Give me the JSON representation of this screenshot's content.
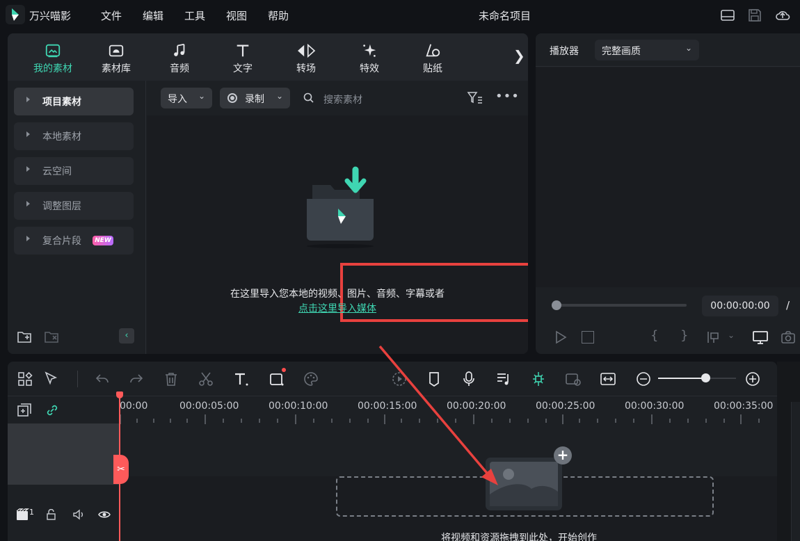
{
  "app": {
    "name": "万兴喵影",
    "project_title": "未命名项目",
    "menus": [
      "文件",
      "编辑",
      "工具",
      "视图",
      "帮助"
    ]
  },
  "media": {
    "tabs": [
      {
        "label": "我的素材",
        "icon": "my-media-icon"
      },
      {
        "label": "素材库",
        "icon": "stock-library-icon"
      },
      {
        "label": "音频",
        "icon": "music-note-icon"
      },
      {
        "label": "文字",
        "icon": "text-t-icon"
      },
      {
        "label": "转场",
        "icon": "transition-icon"
      },
      {
        "label": "特效",
        "icon": "effects-sparkle-icon"
      },
      {
        "label": "贴纸",
        "icon": "sticker-icon"
      }
    ],
    "sidebar": [
      {
        "label": "项目素材"
      },
      {
        "label": "本地素材"
      },
      {
        "label": "云空间"
      },
      {
        "label": "调整图层"
      },
      {
        "label": "复合片段",
        "badge": "NEW"
      }
    ],
    "toolbar": {
      "import_label": "导入",
      "record_label": "录制",
      "search_placeholder": "搜索素材"
    },
    "empty": {
      "text": "在这里导入您本地的视频、图片、音频、字幕或者",
      "link": "点击这里导入媒体"
    }
  },
  "player": {
    "title": "播放器",
    "quality": "完整画质",
    "timecode": "00:00:00:00",
    "separator": "/"
  },
  "timeline": {
    "ruler": [
      "00:00",
      "00:00:05:00",
      "00:00:10:00",
      "00:00:15:00",
      "00:00:20:00",
      "00:00:25:00",
      "00:00:30:00",
      "00:00:35:00"
    ],
    "drop_text": "将视频和资源拖拽到此处，开始创作",
    "video_track_number": "1"
  },
  "colors": {
    "accent": "#3fd6b2",
    "annotation_red": "#e8413e",
    "playhead": "#ff5a5a"
  }
}
